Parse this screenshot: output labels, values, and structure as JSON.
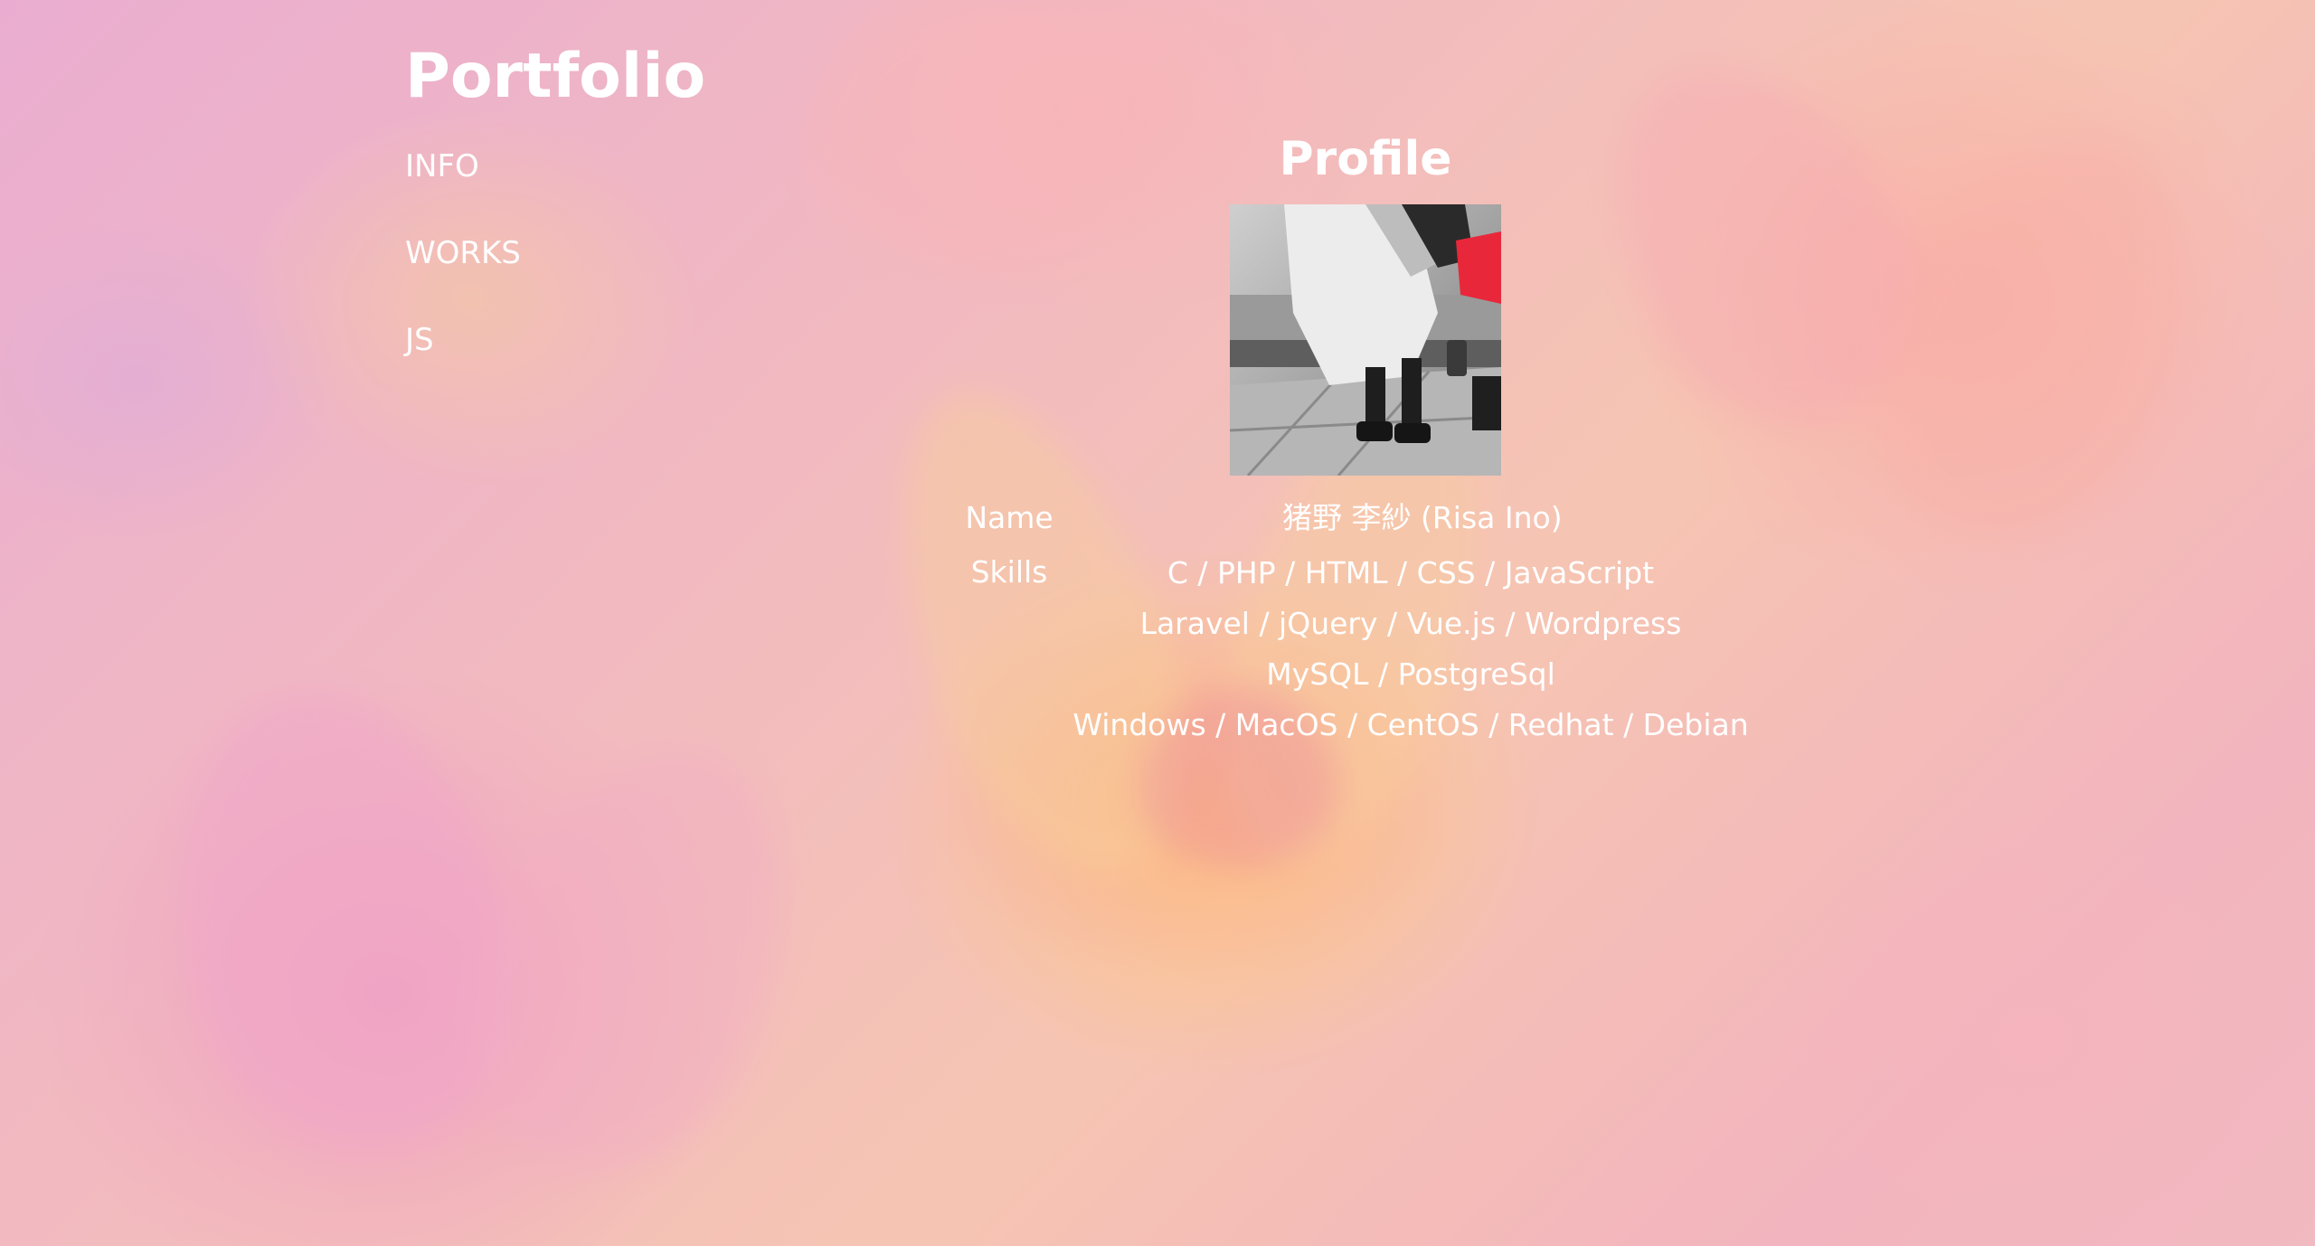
{
  "site": {
    "title": "Portfolio"
  },
  "nav": {
    "items": [
      {
        "label": "INFO"
      },
      {
        "label": "WORKS"
      },
      {
        "label": "JS"
      }
    ]
  },
  "profile": {
    "heading": "Profile",
    "name_label": "Name",
    "name_value": "猪野 李紗 (Risa Ino)",
    "skills_label": "Skills",
    "skills": [
      "C / PHP / HTML / CSS / JavaScript",
      "Laravel / jQuery / Vue.js / Wordpress",
      "MySQL / PostgreSql",
      "Windows / MacOS / CentOS / Redhat / Debian"
    ]
  },
  "colors": {
    "text": "#ffffff",
    "accent_red": "#e8283a"
  },
  "icons": {
    "profile_photo": "person-seated-photo"
  }
}
